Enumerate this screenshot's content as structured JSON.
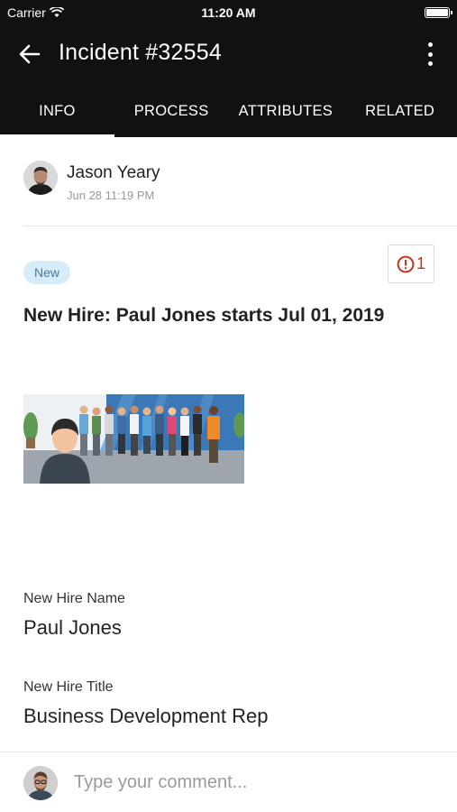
{
  "status_bar": {
    "carrier": "Carrier",
    "time": "11:20 AM"
  },
  "header": {
    "title": "Incident #32554",
    "back_icon": "arrow-left-icon",
    "more_icon": "more-vertical-icon"
  },
  "tabs": [
    {
      "label": "INFO",
      "active": true
    },
    {
      "label": "PROCESS",
      "active": false
    },
    {
      "label": "ATTRIBUTES",
      "active": false
    },
    {
      "label": "RELATED",
      "active": false
    }
  ],
  "author": {
    "name": "Jason Yeary",
    "timestamp": "Jun 28 11:19 PM"
  },
  "incident": {
    "status": "New",
    "alert_count": "1",
    "headline": "New Hire: Paul Jones starts Jul 01, 2019"
  },
  "fields": [
    {
      "label": "New Hire Name",
      "value": "Paul Jones"
    },
    {
      "label": "New Hire Title",
      "value": "Business Development Rep"
    }
  ],
  "comment": {
    "placeholder": "Type your comment..."
  },
  "colors": {
    "header_bg": "#111111",
    "badge_bg": "#d6ecf8",
    "alert": "#c8321f"
  }
}
